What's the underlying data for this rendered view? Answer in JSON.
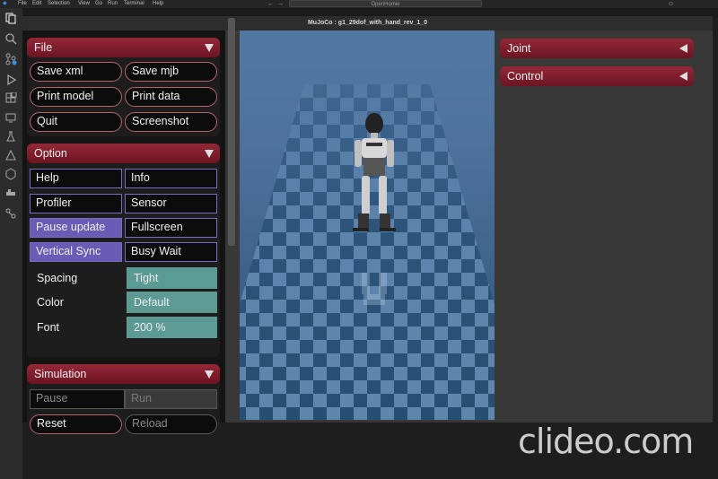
{
  "vscode": {
    "menu": [
      "File",
      "Edit",
      "Selection",
      "View",
      "Go",
      "Run",
      "Terminal",
      "Help"
    ],
    "search_text": "OpenHomie"
  },
  "window": {
    "title": "MuJoCo : g1_29dof_with_hand_rev_1_0"
  },
  "left_panel": {
    "file": {
      "title": "File",
      "buttons": [
        "Save xml",
        "Save mjb",
        "Print model",
        "Print data",
        "Quit",
        "Screenshot"
      ]
    },
    "option": {
      "title": "Option",
      "toggles": [
        {
          "label": "Help",
          "checked": false
        },
        {
          "label": "Info",
          "checked": false
        },
        {
          "label": "Profiler",
          "checked": false
        },
        {
          "label": "Sensor",
          "checked": false
        },
        {
          "label": "Pause update",
          "checked": true
        },
        {
          "label": "Fullscreen",
          "checked": false
        },
        {
          "label": "Vertical Sync",
          "checked": true
        },
        {
          "label": "Busy Wait",
          "checked": false
        }
      ],
      "spacing_label": "Spacing",
      "spacing_value": "Tight",
      "color_label": "Color",
      "color_value": "Default",
      "font_label": "Font",
      "font_value": "200 %"
    },
    "simulation": {
      "title": "Simulation",
      "pause": "Pause",
      "run": "Run",
      "reset": "Reset",
      "reload": "Reload"
    }
  },
  "right_panel": {
    "joint": "Joint",
    "control": "Control"
  },
  "watermark": "clideo.com",
  "colors": {
    "accent": "#8a2233",
    "toggle_on": "#6a5bb7",
    "select": "#5c9a94",
    "floor_blue": "#3c6a8f"
  }
}
